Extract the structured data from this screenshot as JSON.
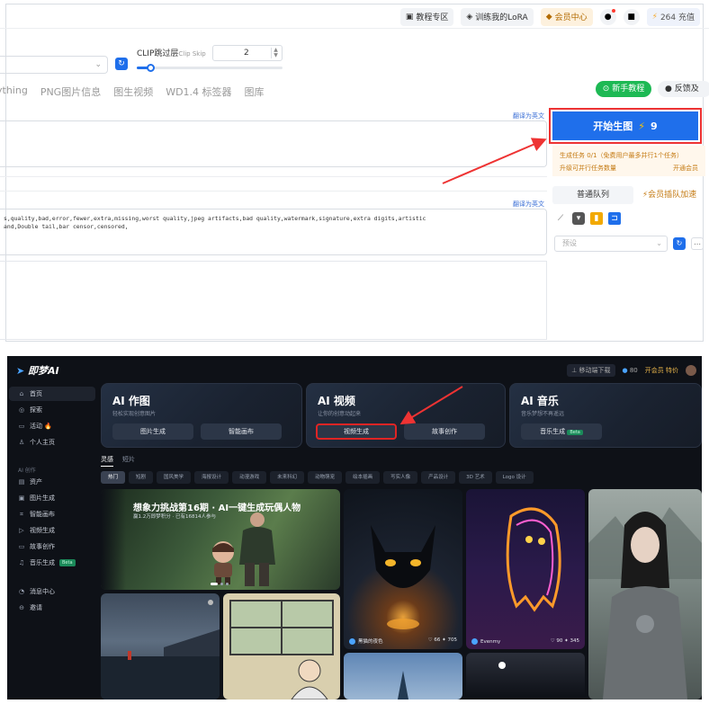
{
  "top_ui": {
    "topbar": {
      "tutorial": "教程专区",
      "train_lora": "训练我的LoRA",
      "member_center": "会员中心",
      "credits": "264 充值"
    },
    "clip_skip": {
      "label": "CLIP跳过层",
      "label_en": "Clip Skip",
      "value": "2",
      "slider_fraction": 0.09
    },
    "tabs": [
      "ything",
      "PNG图片信息",
      "图生视频",
      "WD1.4 标签器",
      "图库"
    ],
    "new_user_tutorial": "新手教程",
    "feedback": "反馈及",
    "translate_link": "翻译为英文",
    "negative_prompt_lines": [
      "s,quality,bad,error,fewer,extra,missing,worst quality,jpeg artifacts,bad quality,watermark,signature,extra digits,artistic",
      "and,Double tail,bar censor,censored,"
    ],
    "generate": {
      "label": "开始生图",
      "cost": "9"
    },
    "task_info": {
      "line1": "生成任务 0/1（免费用户最多并行1个任务）",
      "line2_left": "升级可并行任务数量",
      "line2_right": "开通会员"
    },
    "queue_tabs": [
      "普通队列",
      "会员插队加速"
    ],
    "preset_placeholder": "预设"
  },
  "dark_ui": {
    "logo": "即梦AI",
    "header_right": {
      "mobile_download": "移动端下载",
      "points": "80",
      "open_member": "开会员 特价"
    },
    "sidebar": {
      "items_top": [
        {
          "icon": "home-icon",
          "glyph": "⌂",
          "label": "首页"
        },
        {
          "icon": "explore-icon",
          "glyph": "◎",
          "label": "探索"
        },
        {
          "icon": "event-icon",
          "glyph": "▭",
          "label": "活动 🔥"
        },
        {
          "icon": "user-icon",
          "glyph": "♙",
          "label": "个人主页"
        }
      ],
      "section_label": "AI 创作",
      "items_create": [
        {
          "icon": "assets-icon",
          "glyph": "▤",
          "label": "资产"
        },
        {
          "icon": "image-gen-icon",
          "glyph": "▣",
          "label": "图片生成"
        },
        {
          "icon": "canvas-icon",
          "glyph": "⌗",
          "label": "智能画布"
        },
        {
          "icon": "video-gen-icon",
          "glyph": "▷",
          "label": "视频生成"
        },
        {
          "icon": "story-icon",
          "glyph": "▭",
          "label": "故事创作"
        },
        {
          "icon": "music-icon",
          "glyph": "♫",
          "label": "音乐生成",
          "badge": "Beta"
        }
      ],
      "items_bottom": [
        {
          "icon": "message-icon",
          "glyph": "◔",
          "label": "消息中心"
        },
        {
          "icon": "invite-icon",
          "glyph": "⊖",
          "label": "邀请"
        }
      ]
    },
    "cards": [
      {
        "title": "AI 作图",
        "subtitle": "轻松实现创意图片",
        "buttons": [
          "图片生成",
          "智能画布"
        ]
      },
      {
        "title": "AI 视频",
        "subtitle": "让你的创意动起来",
        "buttons": [
          "视频生成",
          "故事创作"
        ]
      },
      {
        "title": "AI 音乐",
        "subtitle": "音乐梦想不再遥远",
        "buttons": [
          "音乐生成"
        ],
        "badge": "Beta"
      }
    ],
    "subtabs": [
      "灵感",
      "短片"
    ],
    "chips": [
      "热门",
      "短剧",
      "国风美学",
      "海报设计",
      "动漫游戏",
      "未来科幻",
      "动物萌宠",
      "绘本插画",
      "写实人像",
      "产品设计",
      "3D 艺术",
      "Logo 设计"
    ],
    "banner": {
      "title": "想象力挑战第16期 · AI一键生成玩偶人物",
      "meta": "赢1.2万即梦积分 · 已有16814人参与"
    },
    "tiles": [
      {
        "author": "黑猫的夜色",
        "likes": "66",
        "uses": "705"
      },
      {
        "author": "Evenmy",
        "likes": "90",
        "uses": "345"
      }
    ]
  }
}
